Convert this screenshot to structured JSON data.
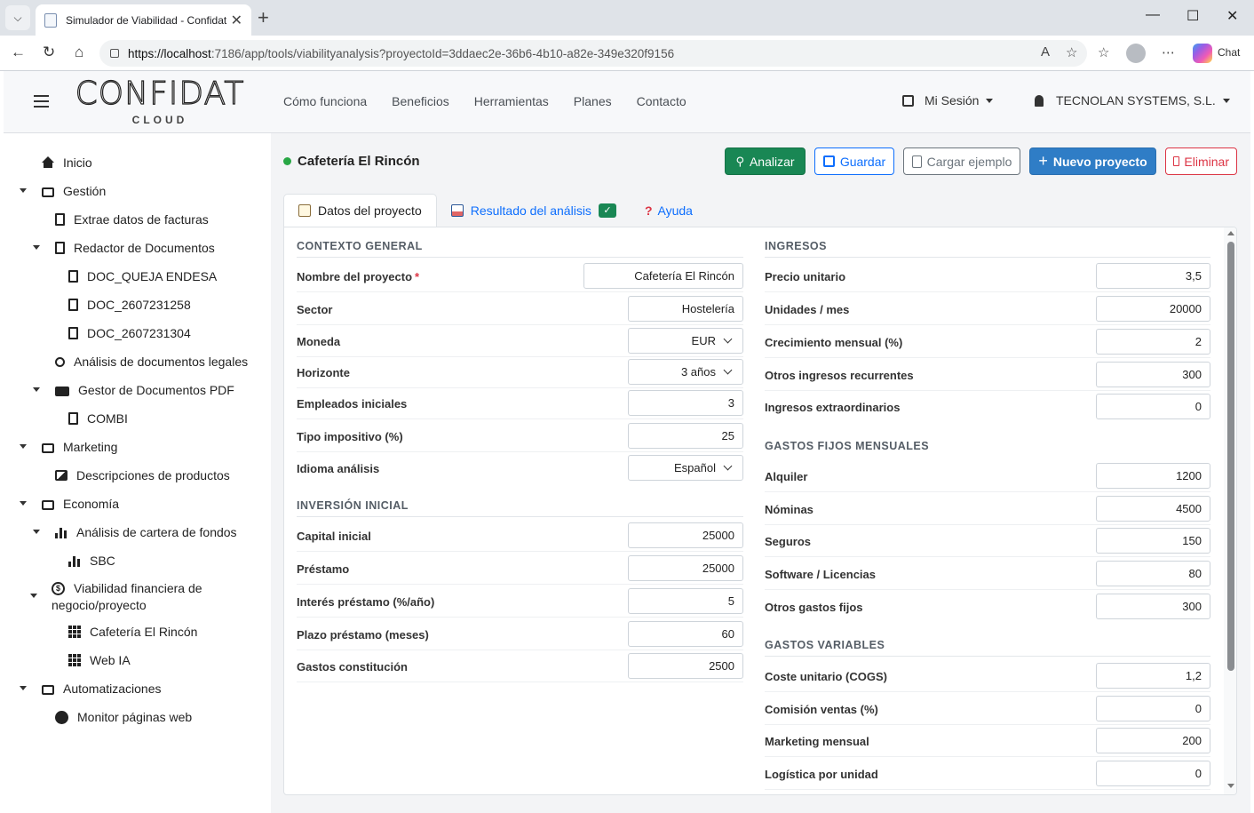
{
  "browser": {
    "tab_title": "Simulador de Viabilidad - Confidat",
    "url_host": "https://localhost",
    "url_rest": ":7186/app/tools/viabilityanalysis?proyectoId=3ddaec2e-36b6-4b10-a82e-349e320f9156",
    "chat_label": "Chat"
  },
  "header": {
    "logo_main": "CONFIDAT",
    "logo_sub": "CLOUD",
    "nav": [
      "Cómo funciona",
      "Beneficios",
      "Herramientas",
      "Planes",
      "Contacto"
    ],
    "session_label": "Mi Sesión",
    "company_label": "TECNOLAN SYSTEMS, S.L."
  },
  "sidebar": {
    "items": [
      {
        "label": "Inicio",
        "icon": "home-icon"
      },
      {
        "label": "Gestión",
        "icon": "briefcase-icon"
      },
      {
        "label": "Extrae datos de facturas",
        "icon": "document-icon"
      },
      {
        "label": "Redactor de Documentos",
        "icon": "document-icon"
      },
      {
        "label": "DOC_QUEJA ENDESA",
        "icon": "document-icon"
      },
      {
        "label": "DOC_2607231258",
        "icon": "document-icon"
      },
      {
        "label": "DOC_2607231304",
        "icon": "document-icon"
      },
      {
        "label": "Análisis de documentos legales",
        "icon": "search-icon"
      },
      {
        "label": "Gestor de Documentos PDF",
        "icon": "folder-icon"
      },
      {
        "label": "COMBI",
        "icon": "document-icon"
      },
      {
        "label": "Marketing",
        "icon": "briefcase-icon"
      },
      {
        "label": "Descripciones de productos",
        "icon": "image-icon"
      },
      {
        "label": "Economía",
        "icon": "briefcase-icon"
      },
      {
        "label": "Análisis de cartera de fondos",
        "icon": "bar-chart-icon"
      },
      {
        "label": "SBC",
        "icon": "bar-chart-icon"
      },
      {
        "label": "Viabilidad financiera de",
        "label2": "negocio/proyecto",
        "icon": "dollar-icon"
      },
      {
        "label": "Cafetería El Rincón",
        "icon": "grid-icon"
      },
      {
        "label": "Web IA",
        "icon": "grid-icon"
      },
      {
        "label": "Automatizaciones",
        "icon": "briefcase-icon"
      },
      {
        "label": "Monitor páginas web",
        "icon": "globe-icon"
      }
    ]
  },
  "main": {
    "project_title": "Cafetería El Rincón",
    "buttons": {
      "analizar": "Analizar",
      "guardar": "Guardar",
      "cargar": "Cargar ejemplo",
      "nuevo": "Nuevo proyecto",
      "eliminar": "Eliminar"
    },
    "tabs": {
      "datos": "Datos del proyecto",
      "resultado": "Resultado del análisis",
      "ayuda": "Ayuda"
    },
    "left": {
      "contexto_title": "CONTEXTO GENERAL",
      "contexto": [
        {
          "label": "Nombre del proyecto",
          "value": "Cafetería El Rincón",
          "required": "*"
        },
        {
          "label": "Sector",
          "value": "Hostelería"
        },
        {
          "label": "Moneda",
          "value": "EUR"
        },
        {
          "label": "Horizonte",
          "value": "3 años"
        },
        {
          "label": "Empleados iniciales",
          "value": "3"
        },
        {
          "label": "Tipo impositivo (%)",
          "value": "25"
        },
        {
          "label": "Idioma análisis",
          "value": "Español"
        }
      ],
      "inversion_title": "INVERSIÓN INICIAL",
      "inversion": [
        {
          "label": "Capital inicial",
          "value": "25000"
        },
        {
          "label": "Préstamo",
          "value": "25000"
        },
        {
          "label": "Interés préstamo (%/año)",
          "value": "5"
        },
        {
          "label": "Plazo préstamo (meses)",
          "value": "60"
        },
        {
          "label": "Gastos constitución",
          "value": "2500"
        }
      ]
    },
    "right": {
      "ingresos_title": "INGRESOS",
      "ingresos": [
        {
          "label": "Precio unitario",
          "value": "3,5"
        },
        {
          "label": "Unidades / mes",
          "value": "20000"
        },
        {
          "label": "Crecimiento mensual (%)",
          "value": "2"
        },
        {
          "label": "Otros ingresos recurrentes",
          "value": "300"
        },
        {
          "label": "Ingresos extraordinarios",
          "value": "0"
        }
      ],
      "fijos_title": "GASTOS FIJOS MENSUALES",
      "fijos": [
        {
          "label": "Alquiler",
          "value": "1200"
        },
        {
          "label": "Nóminas",
          "value": "4500"
        },
        {
          "label": "Seguros",
          "value": "150"
        },
        {
          "label": "Software / Licencias",
          "value": "80"
        },
        {
          "label": "Otros gastos fijos",
          "value": "300"
        }
      ],
      "variables_title": "GASTOS VARIABLES",
      "variables": [
        {
          "label": "Coste unitario (COGS)",
          "value": "1,2"
        },
        {
          "label": "Comisión ventas (%)",
          "value": "0"
        },
        {
          "label": "Marketing mensual",
          "value": "200"
        },
        {
          "label": "Logística por unidad",
          "value": "0"
        }
      ]
    }
  }
}
